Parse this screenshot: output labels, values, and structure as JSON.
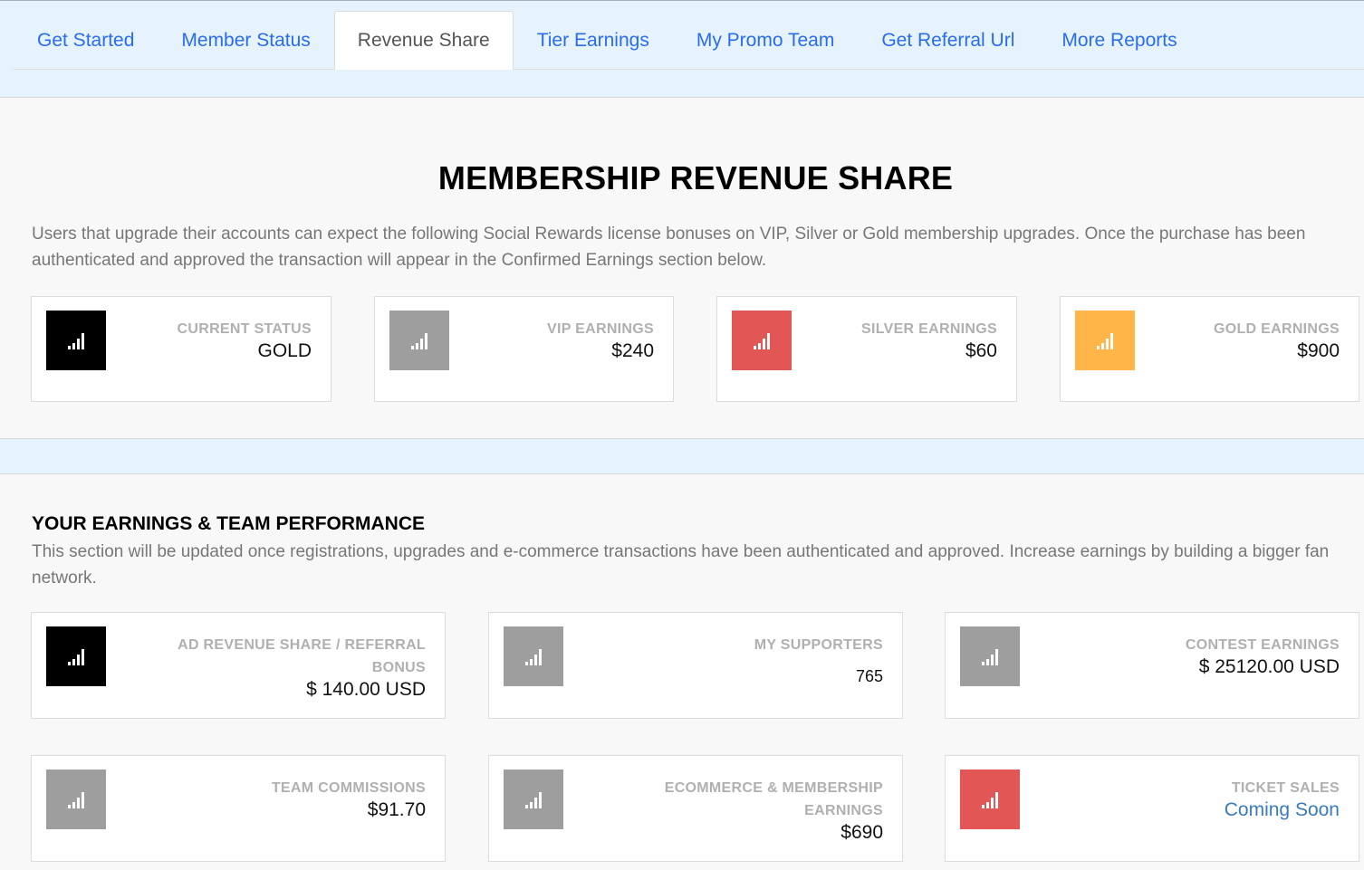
{
  "nav": {
    "tabs": [
      {
        "label": "Get Started",
        "active": false
      },
      {
        "label": "Member Status",
        "active": false
      },
      {
        "label": "Revenue Share",
        "active": true
      },
      {
        "label": "Tier Earnings",
        "active": false
      },
      {
        "label": "My Promo Team",
        "active": false
      },
      {
        "label": "Get Referral Url",
        "active": false
      },
      {
        "label": "More Reports",
        "active": false
      }
    ]
  },
  "revenue_share": {
    "title": "MEMBERSHIP REVENUE SHARE",
    "description": "Users that upgrade their accounts can expect the following Social Rewards license bonuses on VIP, Silver or Gold membership upgrades. Once the purchase has been authenticated and approved the transaction will appear in the Confirmed Earnings section below.",
    "cards": [
      {
        "label": "CURRENT STATUS",
        "value": "GOLD",
        "icon": "signal-bars-icon",
        "color": "#000000"
      },
      {
        "label": "VIP EARNINGS",
        "value": "$240",
        "icon": "signal-bars-icon",
        "color": "#9e9e9e"
      },
      {
        "label": "SILVER EARNINGS",
        "value": "$60",
        "icon": "signal-bars-icon",
        "color": "#e35656"
      },
      {
        "label": "GOLD EARNINGS",
        "value": "$900",
        "icon": "signal-bars-icon",
        "color": "#ffb547"
      }
    ]
  },
  "earnings": {
    "title": "YOUR EARNINGS & TEAM PERFORMANCE",
    "description": "This section will be updated once registrations, upgrades and e-commerce transactions have been authenticated and approved. Increase earnings by building a bigger fan network.",
    "cards": [
      {
        "label_line1": "AD REVENUE SHARE / REFERRAL",
        "label_line2": "BONUS",
        "value": "$ 140.00 USD",
        "icon": "signal-bars-icon",
        "color": "#000000"
      },
      {
        "label_line1": "MY SUPPORTERS",
        "label_line2": "",
        "value": "765",
        "icon": "signal-bars-icon",
        "color": "#9e9e9e"
      },
      {
        "label_line1": "CONTEST EARNINGS",
        "label_line2": "",
        "value": "$ 25120.00 USD",
        "icon": "signal-bars-icon",
        "color": "#9e9e9e"
      },
      {
        "label_line1": "TEAM COMMISSIONS",
        "label_line2": "",
        "value": "$91.70",
        "icon": "signal-bars-icon",
        "color": "#9e9e9e"
      },
      {
        "label_line1": "ECOMMERCE & MEMBERSHIP",
        "label_line2": "EARNINGS",
        "value": "$690",
        "icon": "signal-bars-icon",
        "color": "#9e9e9e"
      },
      {
        "label_line1": "TICKET SALES",
        "label_line2": "",
        "value": "Coming Soon",
        "icon": "signal-bars-icon",
        "color": "#e35656"
      }
    ]
  }
}
